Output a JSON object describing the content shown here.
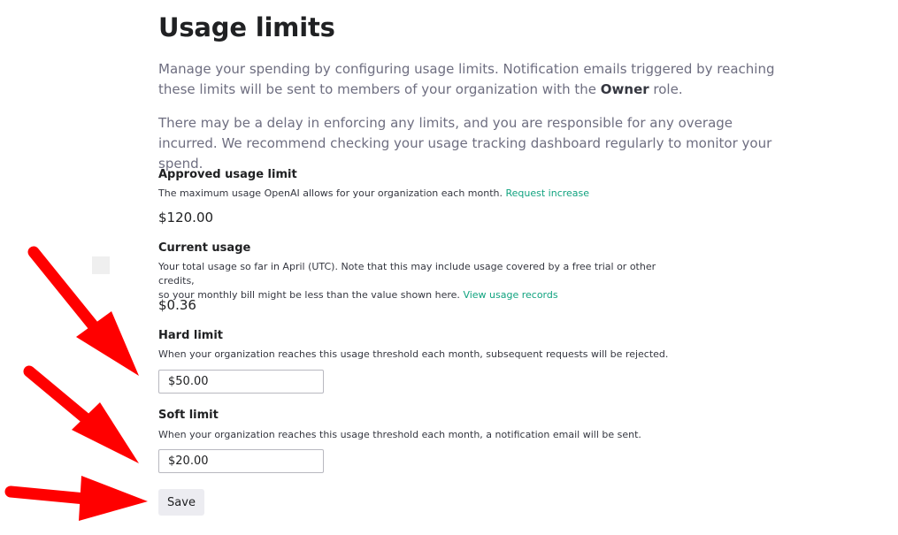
{
  "page": {
    "title": "Usage limits",
    "intro_part1": "Manage your spending by configuring usage limits. Notification emails triggered by reaching these limits will be sent to members of your organization with the ",
    "intro_role": "Owner",
    "intro_part2": " role.",
    "delay_notice": "There may be a delay in enforcing any limits, and you are responsible for any overage incurred. We recommend checking your usage tracking dashboard regularly to monitor your spend."
  },
  "approved": {
    "label": "Approved usage limit",
    "description": "The maximum usage OpenAI allows for your organization each month. ",
    "link": "Request increase",
    "value": "$120.00"
  },
  "current": {
    "label": "Current usage",
    "description_line1": "Your total usage so far in April (UTC). Note that this may include usage covered by a free trial or other credits,",
    "description_line2": "so your monthly bill might be less than the value shown here. ",
    "link": "View usage records",
    "value": "$0.36"
  },
  "hard_limit": {
    "label": "Hard limit",
    "description": "When your organization reaches this usage threshold each month, subsequent requests will be rejected.",
    "value": "$50.00"
  },
  "soft_limit": {
    "label": "Soft limit",
    "description": "When your organization reaches this usage threshold each month, a notification email will be sent.",
    "value": "$20.00"
  },
  "actions": {
    "save_label": "Save"
  },
  "colors": {
    "accent_link": "#10a37f",
    "annotation_arrow": "#ff0000"
  },
  "icons": [
    "arrow-annotation-icon"
  ]
}
